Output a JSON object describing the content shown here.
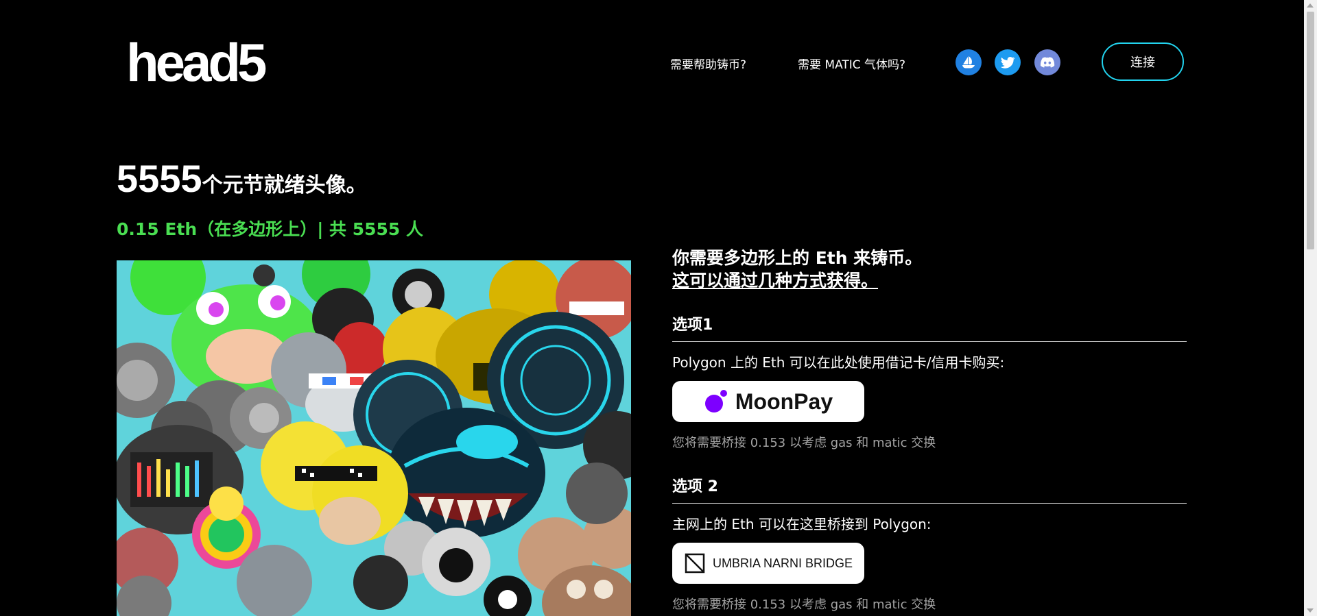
{
  "header": {
    "logo_text": "head5",
    "nav": {
      "help_mint": "需要帮助铸币?",
      "need_matic": "需要 MATIC 气体吗?"
    },
    "socials": [
      {
        "name": "opensea-icon",
        "color": "#2081e2"
      },
      {
        "name": "twitter-icon",
        "color": "#1d9bf0"
      },
      {
        "name": "discord-icon",
        "color": "#7289da"
      }
    ],
    "connect_label": "连接"
  },
  "hero": {
    "title_number": "5555",
    "title_text": "个元节就绪头像。",
    "price_line": "0.15 Eth（在多边形上）| 共 5555 人",
    "image_alt": "头像拼图"
  },
  "right": {
    "intro_line1": "你需要多边形上的 Eth 来铸币。",
    "intro_line2": "这可以通过几种方式获得。",
    "options": [
      {
        "heading": "选项1",
        "description": "Polygon 上的 Eth 可以在此处使用借记卡/信用卡购买:",
        "button_label": "MoonPay",
        "note": "您将需要桥接 0.153 以考虑 gas 和 matic 交换"
      },
      {
        "heading": "选项 2",
        "description": "主网上的 Eth 可以在这里桥接到 Polygon:",
        "button_label": "UMBRIA NARNI BRIDGE",
        "note": "您将需要桥接 0.153 以考虑 gas 和 matic 交换"
      }
    ]
  },
  "colors": {
    "background": "#000000",
    "accent_green": "#4ade52",
    "connect_border": "#22d3ee",
    "moonpay_purple": "#7d00ff",
    "collage_bg": "#5fd3db"
  }
}
